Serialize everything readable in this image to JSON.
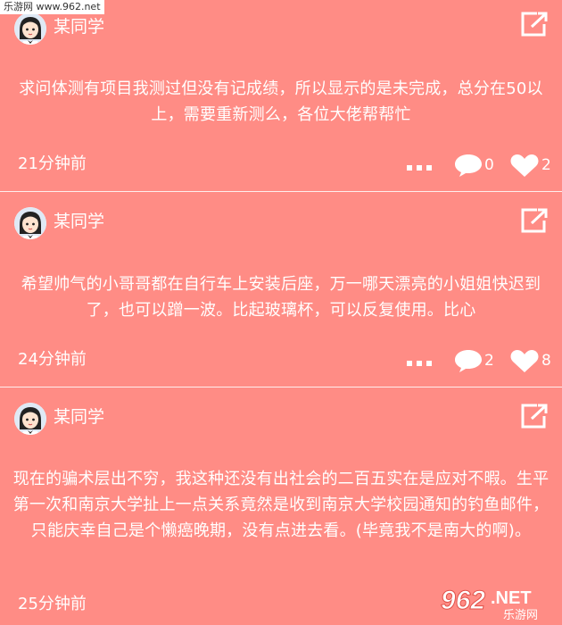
{
  "watermark": {
    "site": "乐游网 www.962.net",
    "logo_main": "962",
    "logo_sub": ".NET",
    "logo_cn": "乐游网"
  },
  "colors": {
    "background": "#ff8c85",
    "text": "#ffffff"
  },
  "posts": [
    {
      "user": "某同学",
      "content": "求问体测有项目我测过但没有记成绩，所以显示的是未完成，总分在50以上，需要重新测么，各位大佬帮帮忙",
      "time": "21分钟前",
      "comments": "0",
      "likes": "2"
    },
    {
      "user": "某同学",
      "content": "希望帅气的小哥哥都在自行车上安装后座，万一哪天漂亮的小姐姐快迟到了，也可以蹭一波。比起玻璃杯，可以反复使用。比心",
      "time": "24分钟前",
      "comments": "2",
      "likes": "8"
    },
    {
      "user": "某同学",
      "content": "现在的骗术层出不穷，我这种还没有出社会的二百五实在是应对不暇。生平第一次和南京大学扯上一点关系竟然是收到南京大学校园通知的钓鱼邮件，只能庆幸自己是个懒癌晚期，没有点进去看。(毕竟我不是南大的啊)。",
      "time": "25分钟前",
      "comments": "",
      "likes": ""
    }
  ],
  "icons": {
    "share": "share-icon",
    "more": "more-icon",
    "comment": "comment-icon",
    "like": "heart-icon"
  }
}
